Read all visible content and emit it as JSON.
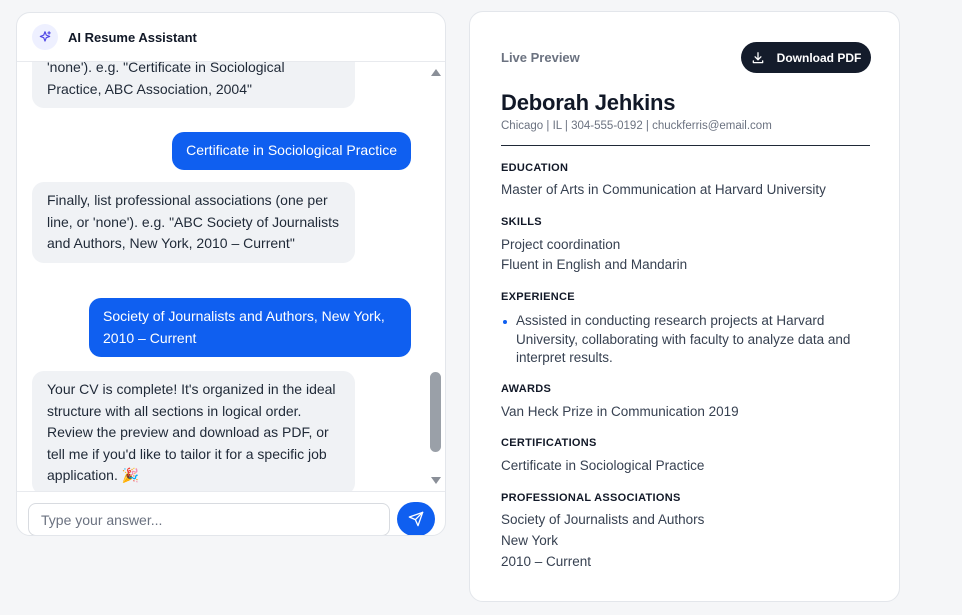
{
  "chat": {
    "title": "AI Resume Assistant",
    "logo_icon": "sparkle-icon",
    "messages": [
      {
        "role": "bot",
        "text": "'none'). e.g. \"Certificate in Sociological Practice, ABC Association, 2004\""
      },
      {
        "role": "user",
        "text": "Certificate in Sociological Practice"
      },
      {
        "role": "bot",
        "text": "Finally, list professional associations (one per line, or 'none'). e.g. \"ABC Society of Journalists and Authors, New York, 2010 – Current\""
      },
      {
        "role": "user",
        "text": "Society of Journalists and Authors, New York, 2010 – Current"
      },
      {
        "role": "bot",
        "text": "Your CV is complete! It's organized in the ideal structure with all sections in logical order. Review the preview and download as PDF, or tell me if you'd like to tailor it for a specific job application. 🎉"
      }
    ],
    "input": {
      "placeholder": "Type your answer...",
      "value": ""
    },
    "send_icon": "send-icon"
  },
  "preview": {
    "label": "Live Preview",
    "download_label": "Download PDF",
    "name": "Deborah Jehkins",
    "contact": "Chicago | IL | 304-555-0192 | chuckferris@email.com",
    "sections": {
      "education": {
        "title": "EDUCATION",
        "lines": [
          "Master of Arts in Communication at Harvard University"
        ]
      },
      "skills": {
        "title": "SKILLS",
        "lines": [
          "Project coordination",
          "Fluent in English and Mandarin"
        ]
      },
      "experience": {
        "title": "EXPERIENCE",
        "bullets": [
          "Assisted in conducting research projects at Harvard University, collaborating with faculty to analyze data and interpret results."
        ]
      },
      "awards": {
        "title": "AWARDS",
        "lines": [
          "Van Heck Prize in Communication 2019"
        ]
      },
      "certifications": {
        "title": "CERTIFICATIONS",
        "lines": [
          "Certificate in Sociological Practice"
        ]
      },
      "associations": {
        "title": "PROFESSIONAL ASSOCIATIONS",
        "lines": [
          "Society of Journalists and Authors",
          "New York",
          "2010 – Current"
        ]
      }
    }
  },
  "colors": {
    "accent": "#0f5ff0",
    "dark_button": "#141c2b"
  }
}
